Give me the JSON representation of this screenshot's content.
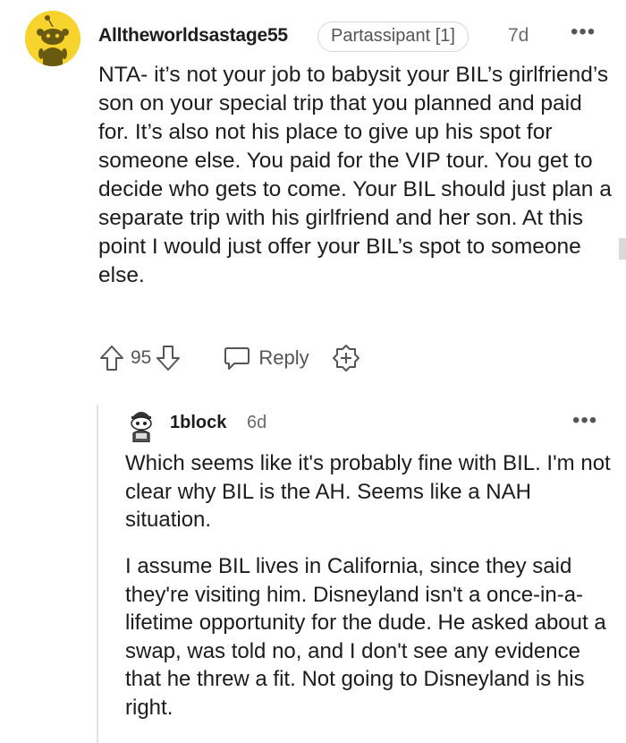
{
  "comment": {
    "username": "Alltheworldsastage55",
    "flair": "Partassipant [1]",
    "time": "7d",
    "more_icon": "more-dots-icon",
    "body": "NTA- it’s not your job to babysit your BIL’s girlfriend’s son on your special trip that you planned and paid for. It’s also not his place to give up his spot for someone else. You paid for the VIP tour. You get to decide who gets to come. Your BIL should just plan a separate trip with his girlfriend and her son. At this point I would just offer your BIL’s spot to someone else.",
    "score": "95",
    "reply_label": "Reply",
    "avatar_color": "#f6d32d"
  },
  "reply": {
    "username": "1block",
    "time": "6d",
    "paragraph_1": "Which seems like it's probably fine with BIL. I'm not clear why BIL is the AH. Seems like a NAH situation.",
    "paragraph_2": "I assume BIL lives in California, since they said they're visiting him. Disneyland isn't a once-in-a-lifetime opportunity for the dude. He asked about a swap, was told no, and I don't see any evidence that he threw a fit. Not going to Disneyland is his right."
  }
}
